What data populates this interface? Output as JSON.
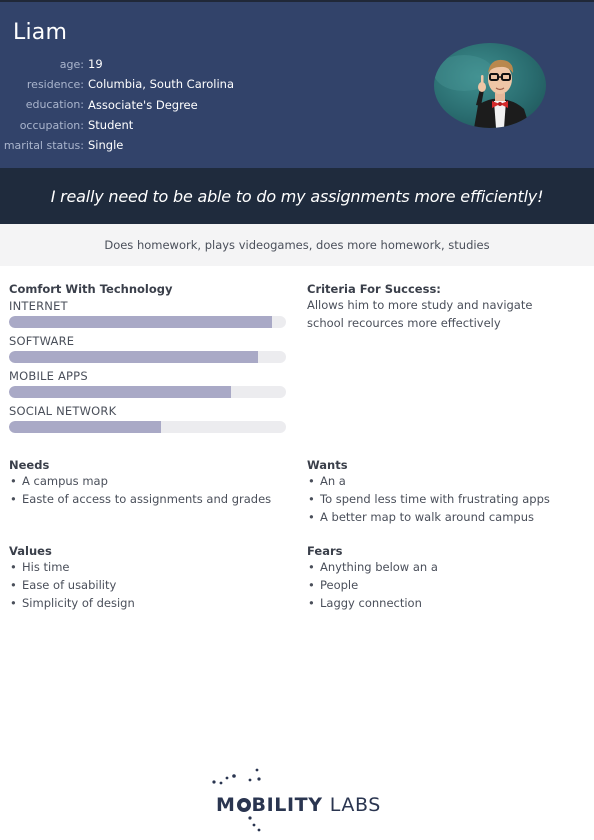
{
  "persona": {
    "name": "Liam",
    "facts": [
      {
        "key": "age:",
        "value": "19"
      },
      {
        "key": "residence:",
        "value": "Columbia, South Carolina"
      },
      {
        "key": "education:",
        "value": "Associate's Degree"
      },
      {
        "key": "occupation:",
        "value": "Student"
      },
      {
        "key": "marital status:",
        "value": "Single"
      }
    ],
    "avatar_icon": "student-photo",
    "quote": "I really need to be able to do my assignments more efficiently!",
    "activities": "Does homework, plays videogames, does more homework, studies"
  },
  "technology": {
    "title": "Comfort With Technology",
    "items": [
      {
        "label": "INTERNET",
        "level": 0.95
      },
      {
        "label": "SOFTWARE",
        "level": 0.9
      },
      {
        "label": "MOBILE APPS",
        "level": 0.8
      },
      {
        "label": "SOCIAL NETWORK",
        "level": 0.55
      }
    ]
  },
  "criteria": {
    "title": "Criteria For Success:",
    "text": "Allows him to more study and navigate school recources more effectively"
  },
  "needs": {
    "title": "Needs",
    "items": [
      "A campus map",
      "Easte of access to assignments and grades"
    ]
  },
  "wants": {
    "title": "Wants",
    "items": [
      "An a",
      "To spend less time with frustrating apps",
      "A better map to walk around campus"
    ]
  },
  "values": {
    "title": "Values",
    "items": [
      "His time",
      "Ease of usability",
      "Simplicity of design"
    ]
  },
  "fears": {
    "title": "Fears",
    "items": [
      "Anything below an a",
      "People",
      "Laggy connection"
    ]
  },
  "brand": {
    "logo_m": "M",
    "logo_bility": "BILITY",
    "logo_labs": "LABS",
    "accent": "#2a3550"
  },
  "colors": {
    "header": "#32436a",
    "quote_band": "#1f2b3d",
    "bar_fill": "#a9a9c6"
  }
}
